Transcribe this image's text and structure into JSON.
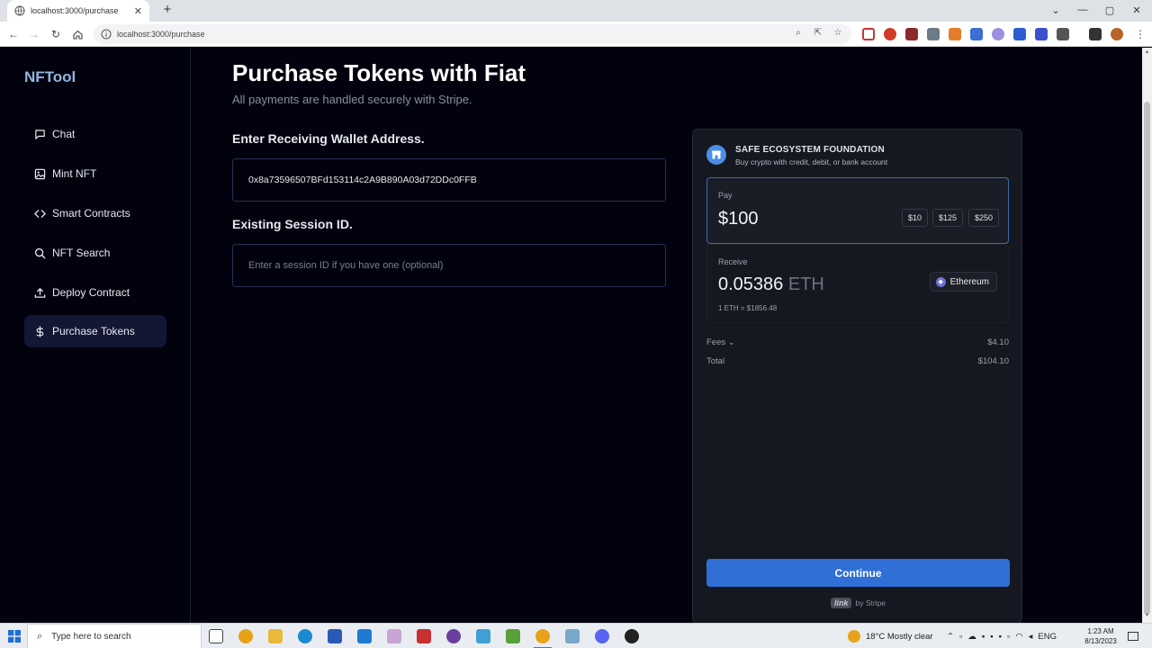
{
  "browser": {
    "tab_title": "localhost:3000/purchase",
    "url": "localhost:3000/purchase"
  },
  "sidebar": {
    "brand": "NFTool",
    "items": [
      {
        "label": "Chat",
        "icon": "message-square-icon"
      },
      {
        "label": "Mint NFT",
        "icon": "image-icon"
      },
      {
        "label": "Smart Contracts",
        "icon": "code-icon"
      },
      {
        "label": "NFT Search",
        "icon": "search-icon"
      },
      {
        "label": "Deploy Contract",
        "icon": "upload-icon"
      },
      {
        "label": "Purchase Tokens",
        "icon": "dollar-icon",
        "active": true
      }
    ]
  },
  "main": {
    "title": "Purchase Tokens with Fiat",
    "subtitle": "All payments are handled securely with Stripe.",
    "wallet_label": "Enter Receiving Wallet Address.",
    "wallet_value": "0x8a73596507BFd153114c2A9B890A03d72DDc0FFB",
    "session_label": "Existing Session ID.",
    "session_placeholder": "Enter a session ID if you have one (optional)"
  },
  "widget": {
    "org_name": "SAFE ECOSYSTEM FOUNDATION",
    "org_desc": "Buy crypto with credit, debit, or bank account",
    "pay_label": "Pay",
    "pay_amount": "$100",
    "presets": [
      "$10",
      "$125",
      "$250"
    ],
    "receive_label": "Receive",
    "receive_amount": "0.05386",
    "receive_unit": "ETH",
    "currency": "Ethereum",
    "rate": "1 ETH = $1856.48",
    "fees_label": "Fees",
    "fees_value": "$4.10",
    "total_label": "Total",
    "total_value": "$104.10",
    "continue_label": "Continue",
    "link_logo": "link",
    "powered_by": "by Stripe"
  },
  "taskbar": {
    "search_placeholder": "Type here to search",
    "weather": "18°C  Mostly clear",
    "lang": "ENG",
    "time": "1:23 AM",
    "date": "8/13/2023"
  },
  "colors": {
    "background": "#02020f",
    "brand": "#8fb6dd",
    "accent": "#2f6fd6",
    "widget_bg": "#151820"
  }
}
